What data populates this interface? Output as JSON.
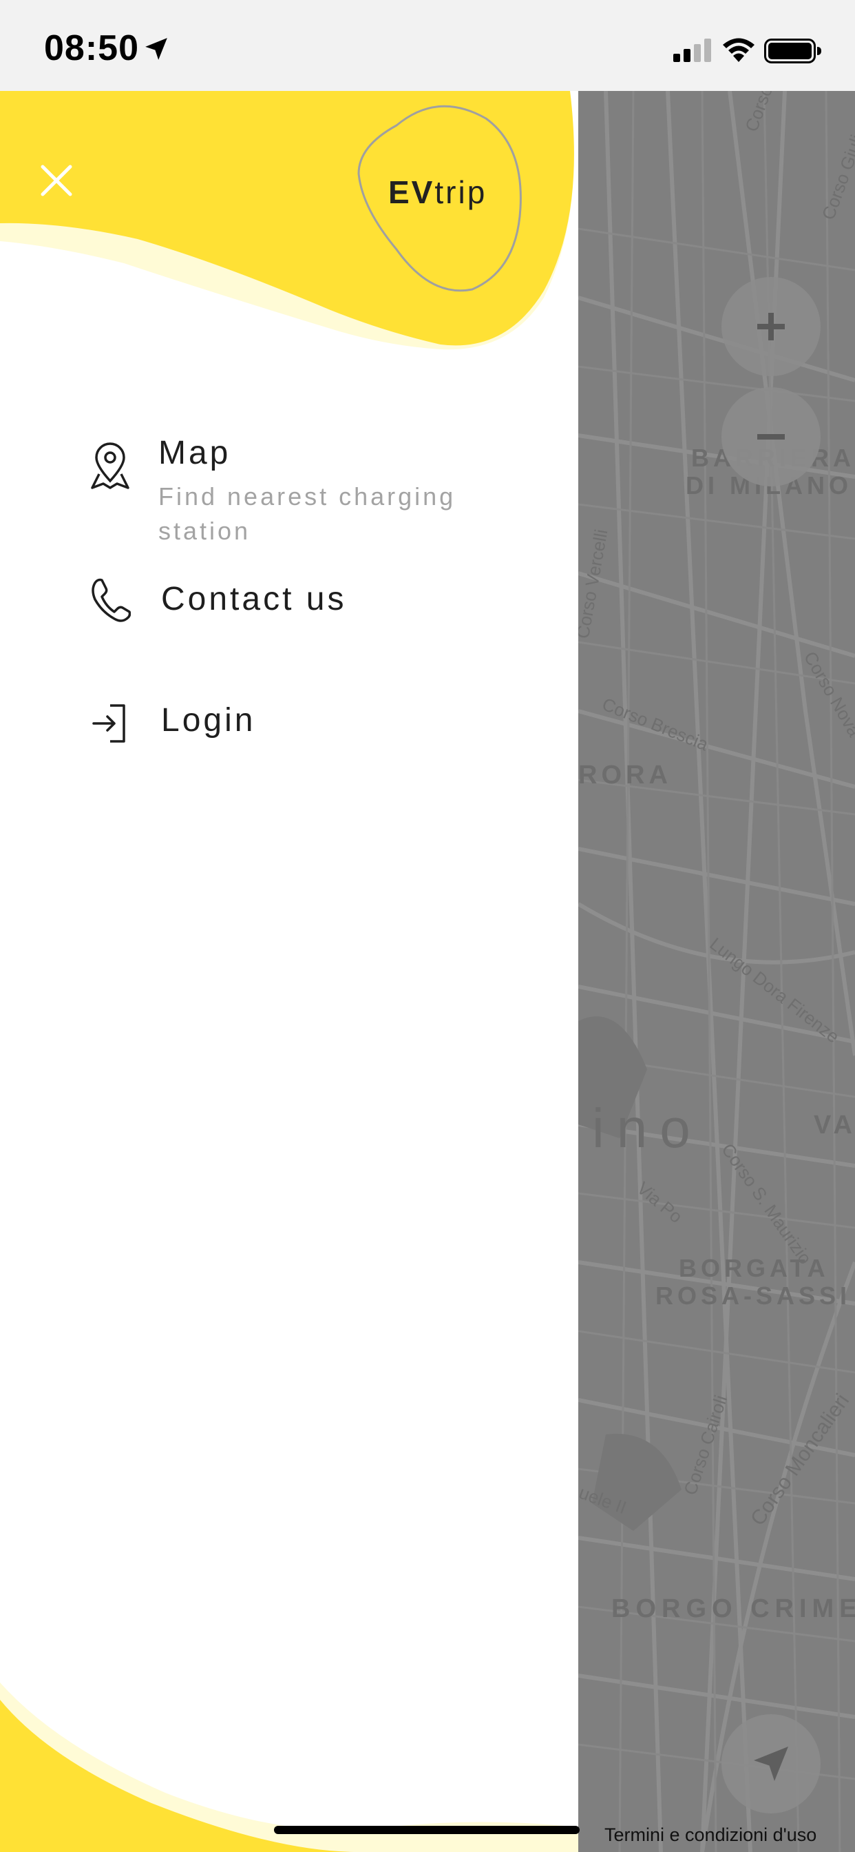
{
  "status_bar": {
    "time": "08:50"
  },
  "drawer": {
    "brand": {
      "bold": "EV",
      "regular": "trip"
    },
    "menu": [
      {
        "label": "Map",
        "subtitle": "Find nearest charging station",
        "icon": "map-pin-icon"
      },
      {
        "label": "Contact us",
        "icon": "phone-icon"
      },
      {
        "label": "Login",
        "icon": "login-icon"
      }
    ]
  },
  "map": {
    "labels": {
      "district_1_line1": "BARRIERA",
      "district_1_line2": "DI MILANO",
      "aurora": "RORA",
      "torino": "ino",
      "vanchiglia": "VA",
      "borgata_line1": "BORGATA",
      "borgata_line2": "ROSA-SASSI",
      "borgo": "BORGO CRIME"
    },
    "streets": {
      "corso_top": "Corso",
      "corso_giulio": "Corso Giuli",
      "corso_vercelli": "Corso Vercelli",
      "corso_novara": "Corso Nova",
      "corso_brescia": "Corso Brescia",
      "lungo_dora": "Lungo Dora Firenze",
      "corso_maurizio": "Corso S. Maurizio",
      "via_po": "Via Po",
      "emanuele": "uele II",
      "corso_cairoli": "Corso Cairoli",
      "corso_moncalieri": "Corso Moncalieri"
    },
    "terms": "Termini e condizioni d'uso",
    "colors": {
      "map_bg": "#7f7f7f",
      "accent": "#ffe135"
    }
  }
}
